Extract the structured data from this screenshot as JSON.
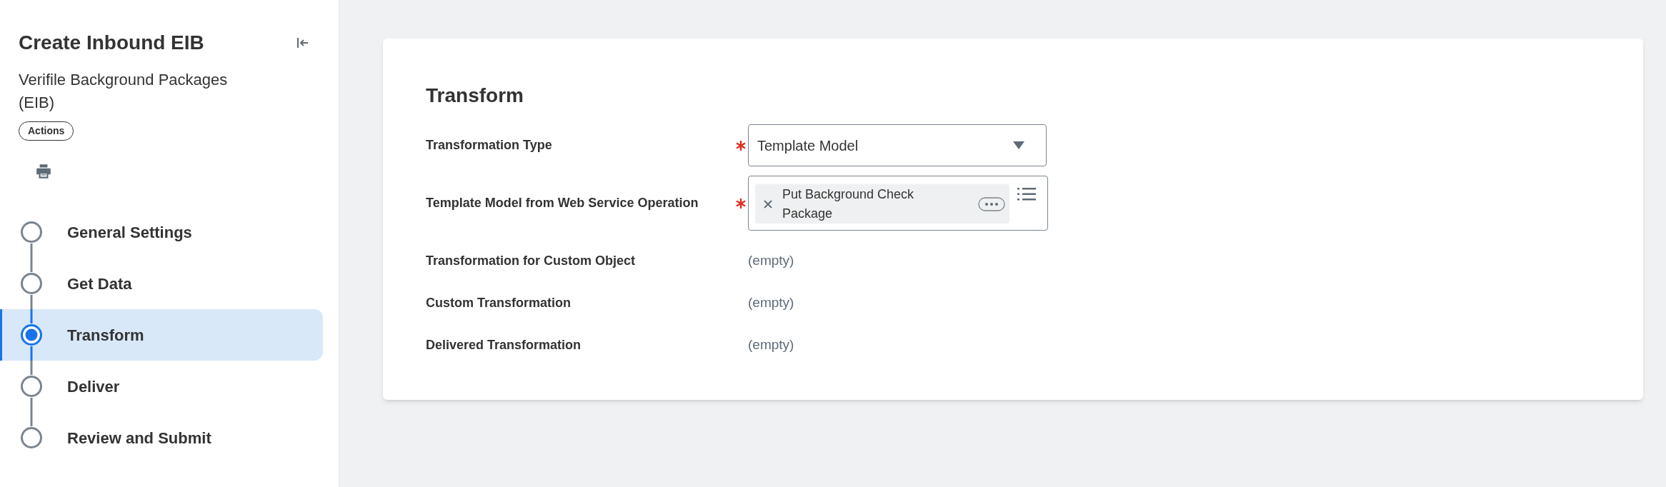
{
  "sidebar": {
    "title": "Create Inbound EIB",
    "subtitle": "Verifile Background Packages (EIB)",
    "actions_button": "Actions",
    "steps": [
      {
        "label": "General Settings",
        "selected": false
      },
      {
        "label": "Get Data",
        "selected": false
      },
      {
        "label": "Transform",
        "selected": true
      },
      {
        "label": "Deliver",
        "selected": false
      },
      {
        "label": "Review and Submit",
        "selected": false
      }
    ]
  },
  "form": {
    "title": "Transform",
    "fields": [
      {
        "kind": "select",
        "label": "Transformation Type",
        "required": true,
        "value": "Template Model"
      },
      {
        "kind": "multiselect",
        "label": "Template Model from Web Service Operation",
        "required": true,
        "tokens": [
          "Put Background Check Package"
        ]
      },
      {
        "kind": "readonly",
        "label": "Transformation for Custom Object",
        "value": "(empty)"
      },
      {
        "kind": "readonly",
        "label": "Custom Transformation",
        "value": "(empty)"
      },
      {
        "kind": "readonly",
        "label": "Delivered Transformation",
        "value": "(empty)"
      }
    ]
  }
}
